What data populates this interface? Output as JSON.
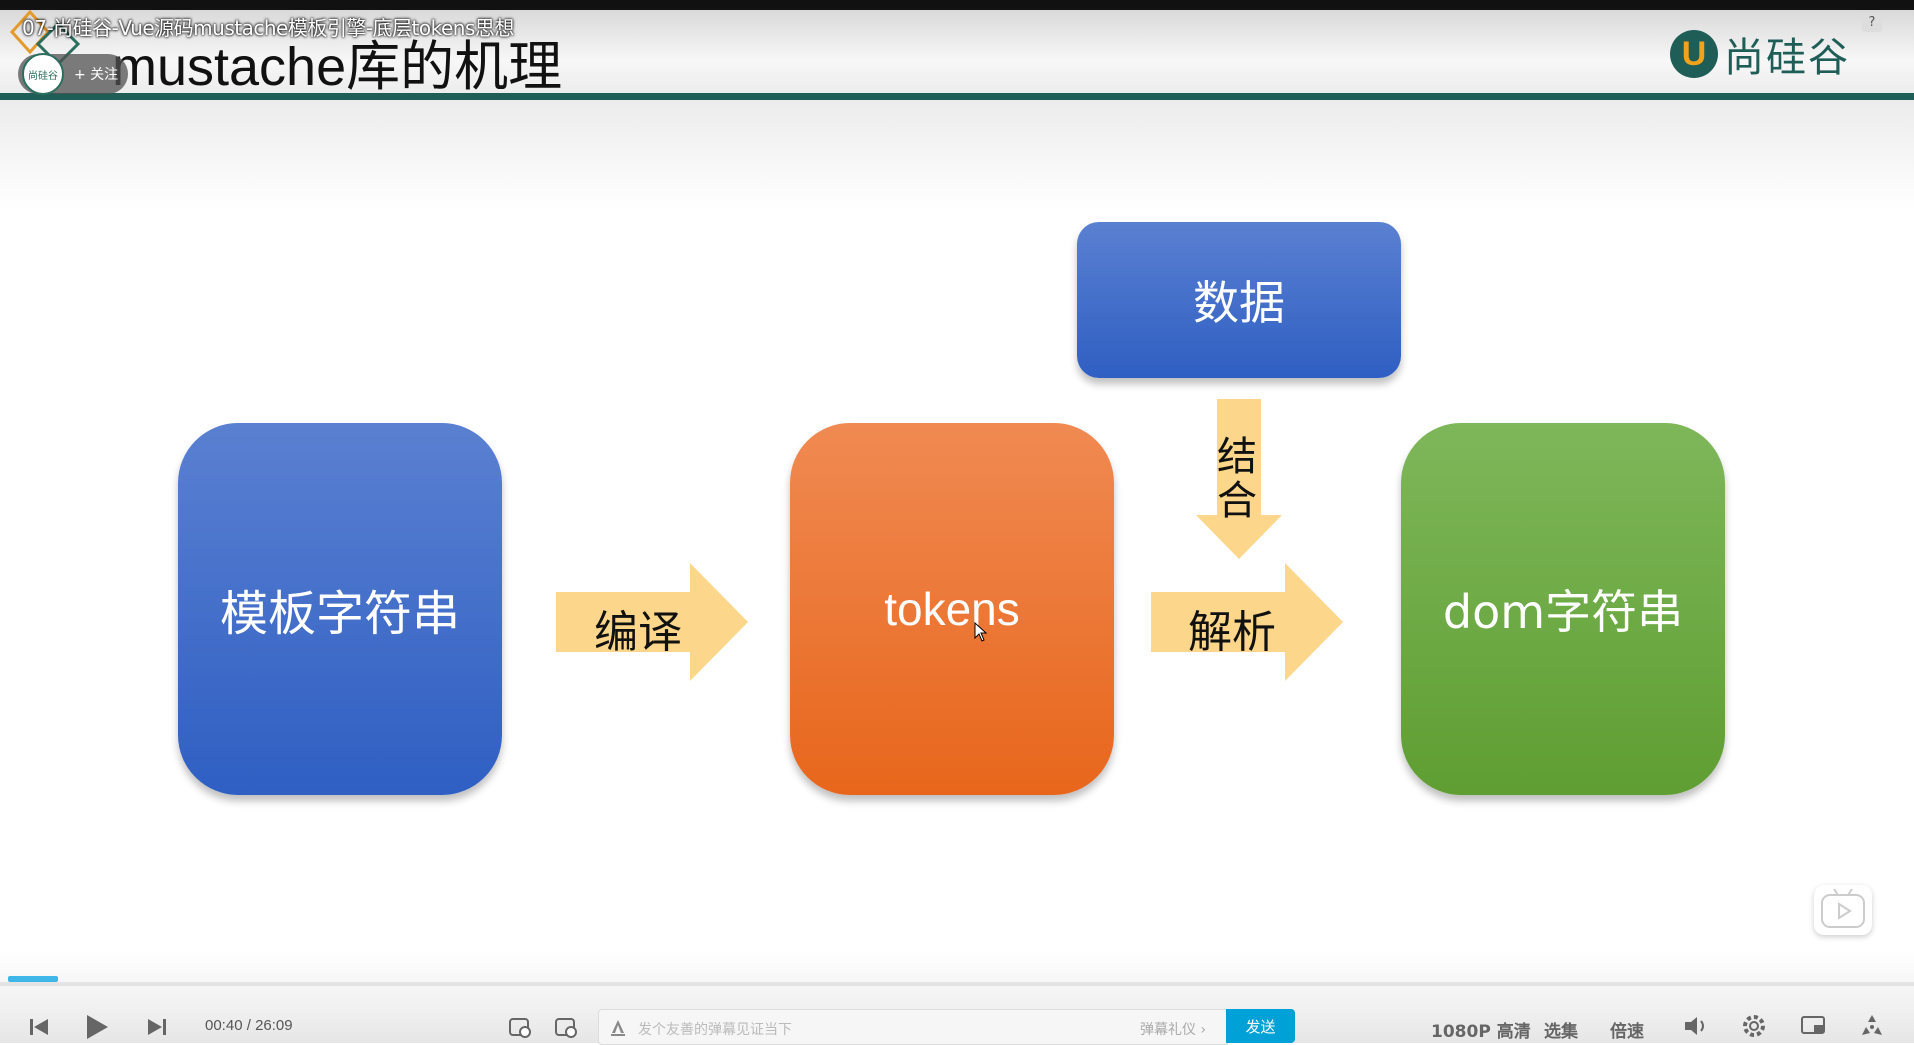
{
  "video": {
    "title": "07-尚硅谷-Vue源码mustache模板引擎-底层tokens思想"
  },
  "channel": {
    "avatar_text": "尚硅谷",
    "follow_label": "+ 关注"
  },
  "slide": {
    "title": "mustache库的机理",
    "logo_letter": "U",
    "logo_text": "尚硅谷",
    "boxes": {
      "template": "模板字符串",
      "tokens": "tokens",
      "dom": "dom字符串",
      "data": "数据"
    },
    "arrows": {
      "compile": "编译",
      "parse": "解析",
      "combine_1": "结",
      "combine_2": "合"
    },
    "colors": {
      "blue": "#2f5fc3",
      "orange": "#e8661c",
      "green": "#5f9e32",
      "arrow": "#fcd68a",
      "brand": "#1f5e57"
    }
  },
  "player": {
    "help": "?",
    "progress": 0.0255,
    "current_time": "00:40",
    "time_sep": "/",
    "duration": "26:09",
    "danmaku_placeholder": "发个友善的弹幕见证当下",
    "danmaku_etiquette": "弹幕礼仪 ›",
    "send_label": "发送",
    "quality_label": "1080P 高清",
    "episodes_label": "选集",
    "speed_label": "倍速"
  }
}
